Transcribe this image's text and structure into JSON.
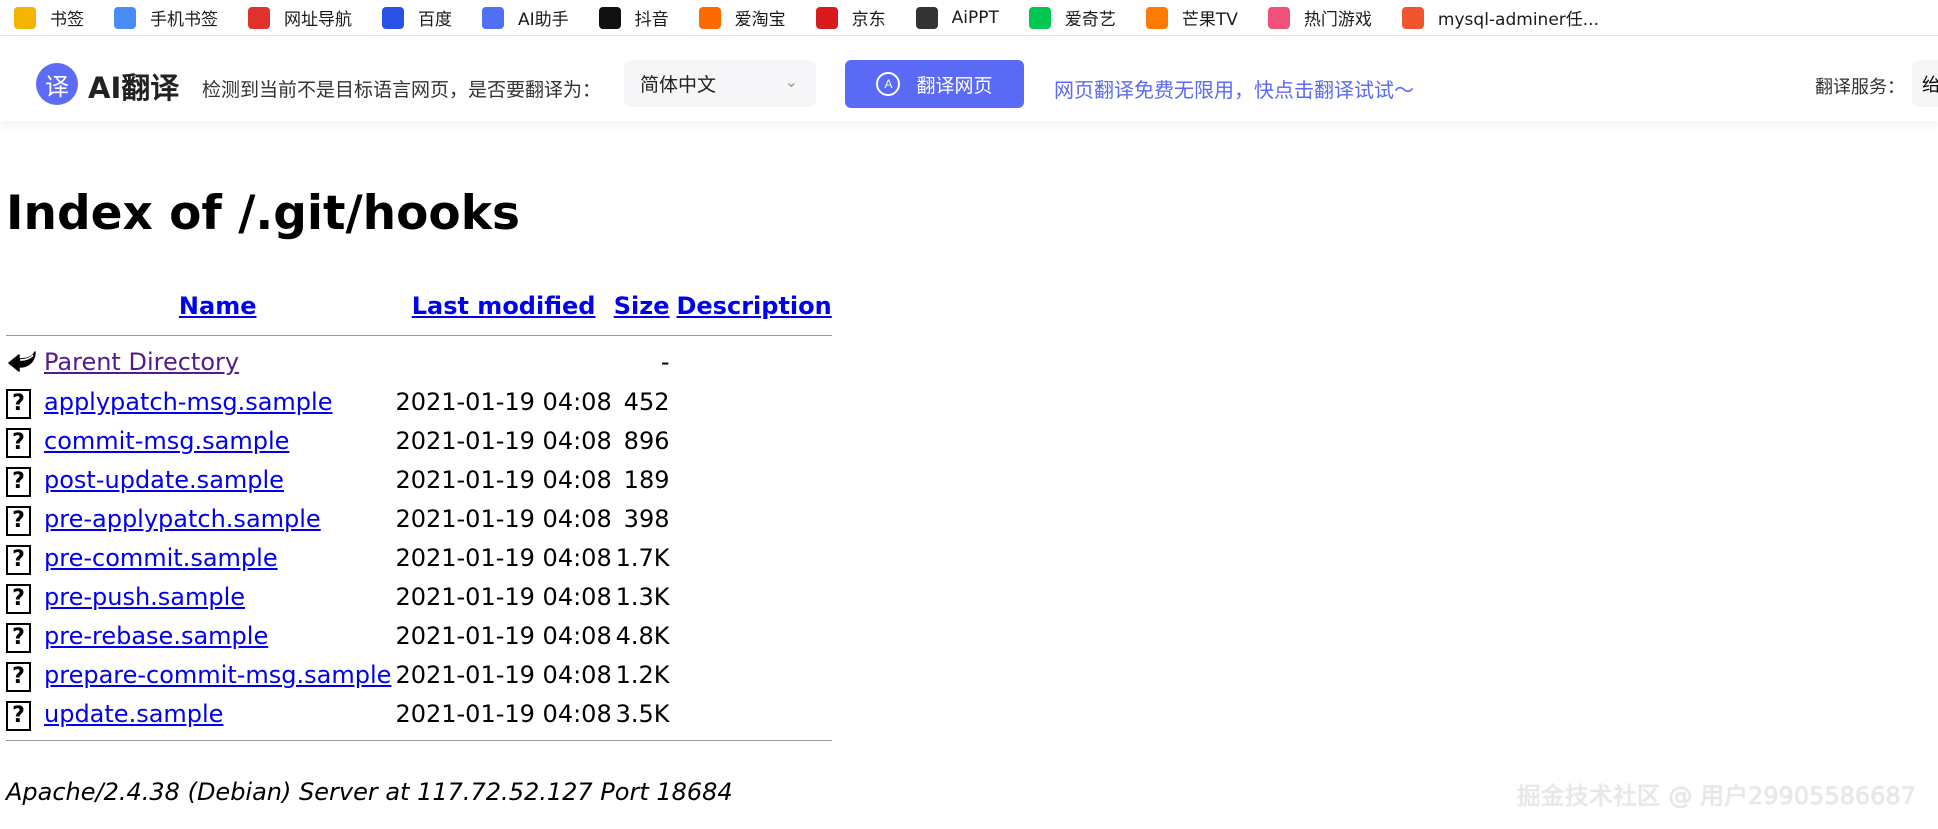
{
  "bookmarks": [
    {
      "label": "书签",
      "icon": "star-icon",
      "color": "#f5b400"
    },
    {
      "label": "手机书签",
      "icon": "phone-icon",
      "color": "#4a8cf5"
    },
    {
      "label": "网址导航",
      "icon": "navigation-icon",
      "color": "#e0312a"
    },
    {
      "label": "百度",
      "icon": "baidu-paw-icon",
      "color": "#2a51e6"
    },
    {
      "label": "AI助手",
      "icon": "ai-assistant-icon",
      "color": "#4f6ff5"
    },
    {
      "label": "抖音",
      "icon": "douyin-icon",
      "color": "#111111"
    },
    {
      "label": "爱淘宝",
      "icon": "taobao-icon",
      "color": "#ff6a00"
    },
    {
      "label": "京东",
      "icon": "jd-icon",
      "color": "#d71a1b"
    },
    {
      "label": "AiPPT",
      "icon": "aippt-icon",
      "color": "#333333"
    },
    {
      "label": "爱奇艺",
      "icon": "iqiyi-icon",
      "color": "#00c853"
    },
    {
      "label": "芒果TV",
      "icon": "mangotv-icon",
      "color": "#ff7a00"
    },
    {
      "label": "热门游戏",
      "icon": "games-icon",
      "color": "#f0507a"
    },
    {
      "label": "mysql-adminer任...",
      "icon": "csdn-icon",
      "color": "#f2542d"
    }
  ],
  "translate_bar": {
    "brand": "AI翻译",
    "logo_char": "译",
    "prompt": "检测到当前不是目标语言网页，是否要翻译为：",
    "target_language": "简体中文",
    "translate_button": "翻译网页",
    "promo": "网页翻译免费无限用，快点击翻译试试～",
    "service_label": "翻译服务：",
    "service_value": "绐",
    "accent_color": "#5b6af5"
  },
  "page": {
    "title": "Index of /.git/hooks",
    "columns": {
      "name": "Name",
      "last_modified": "Last modified",
      "size": "Size",
      "description": "Description"
    },
    "parent": {
      "name": "Parent Directory",
      "size": "-"
    },
    "files": [
      {
        "name": "applypatch-msg.sample",
        "modified": "2021-01-19 04:08",
        "size": "452"
      },
      {
        "name": "commit-msg.sample",
        "modified": "2021-01-19 04:08",
        "size": "896"
      },
      {
        "name": "post-update.sample",
        "modified": "2021-01-19 04:08",
        "size": "189"
      },
      {
        "name": "pre-applypatch.sample",
        "modified": "2021-01-19 04:08",
        "size": "398"
      },
      {
        "name": "pre-commit.sample",
        "modified": "2021-01-19 04:08",
        "size": "1.7K"
      },
      {
        "name": "pre-push.sample",
        "modified": "2021-01-19 04:08",
        "size": "1.3K"
      },
      {
        "name": "pre-rebase.sample",
        "modified": "2021-01-19 04:08",
        "size": "4.8K"
      },
      {
        "name": "prepare-commit-msg.sample",
        "modified": "2021-01-19 04:08",
        "size": "1.2K"
      },
      {
        "name": "update.sample",
        "modified": "2021-01-19 04:08",
        "size": "3.5K"
      }
    ],
    "file_icon_glyph": "?",
    "address": "Apache/2.4.38 (Debian) Server at 117.72.52.127 Port 18684"
  },
  "watermark": "掘金技术社区 @ 用户29905586687"
}
